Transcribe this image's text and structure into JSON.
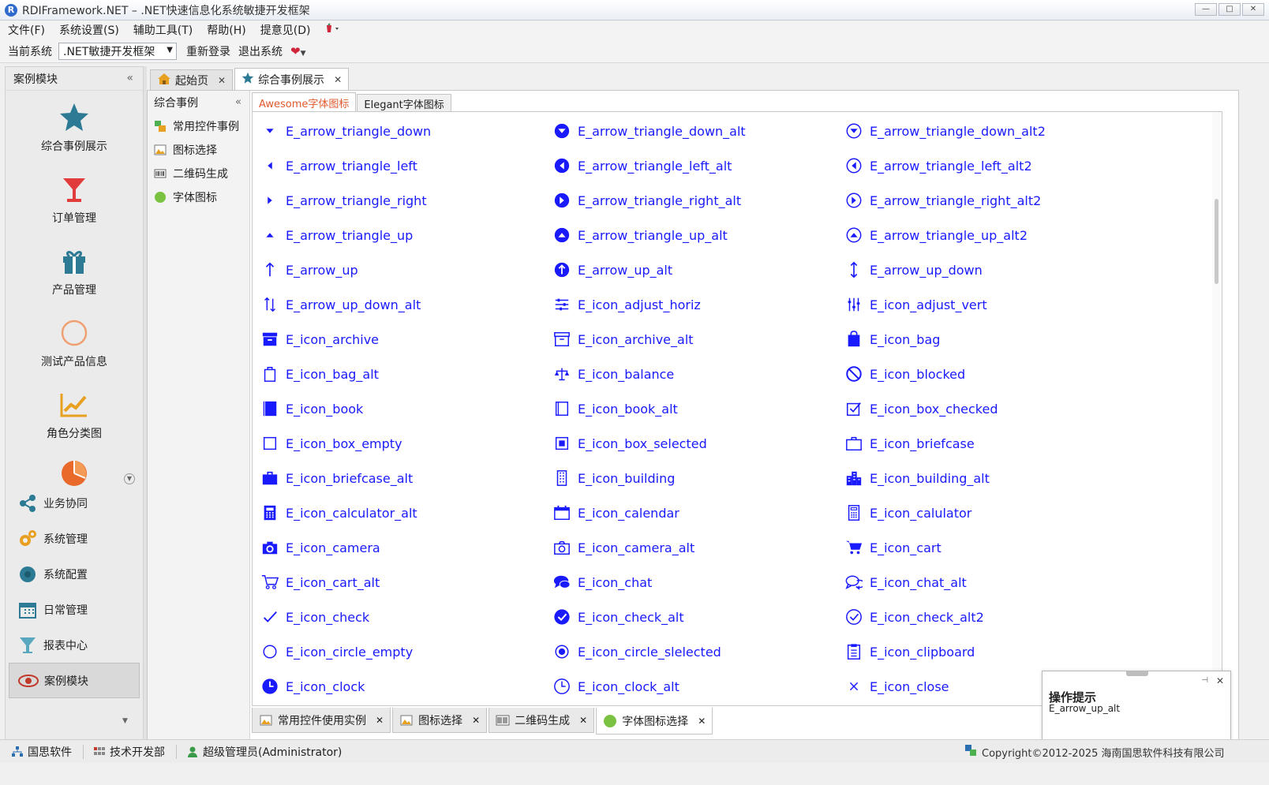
{
  "window": {
    "title": "RDIFramework.NET – .NET快速信息化系统敏捷开发框架",
    "logo_letter": "R",
    "buttons": [
      "—",
      "□",
      "✕"
    ]
  },
  "menu": {
    "items": [
      "文件(F)",
      "系统设置(S)",
      "辅助工具(T)",
      "帮助(H)",
      "提意见(D)"
    ]
  },
  "toolbar": {
    "current_system_label": "当前系统",
    "system_select_value": ".NET敏捷开发框架",
    "relogin_label": "重新登录",
    "exit_label": "退出系统"
  },
  "leftnav": {
    "title": "案例模块",
    "big_items": [
      {
        "label": "综合事例展示",
        "icon": "star-icon"
      },
      {
        "label": "订单管理",
        "icon": "cocktail-icon"
      },
      {
        "label": "产品管理",
        "icon": "gift-icon"
      },
      {
        "label": "测试产品信息",
        "icon": "circle-icon"
      },
      {
        "label": "角色分类图",
        "icon": "chart-icon"
      },
      {
        "label": "",
        "icon": "pie-icon"
      }
    ],
    "small_items": [
      {
        "label": "业务协同",
        "icon": "share-icon"
      },
      {
        "label": "系统管理",
        "icon": "gears-icon"
      },
      {
        "label": "系统配置",
        "icon": "cog-icon"
      },
      {
        "label": "日常管理",
        "icon": "calendar-icon"
      },
      {
        "label": "报表中心",
        "icon": "funnel-icon"
      },
      {
        "label": "案例模块",
        "icon": "eye-icon"
      }
    ]
  },
  "doc_tabs": [
    {
      "label": "起始页",
      "icon": "home-icon"
    },
    {
      "label": "综合事例展示",
      "icon": "star-icon"
    }
  ],
  "subnav": {
    "title": "综合事例",
    "items": [
      {
        "label": "常用控件事例"
      },
      {
        "label": "图标选择"
      },
      {
        "label": "二维码生成"
      },
      {
        "label": "字体图标"
      }
    ]
  },
  "icon_tabs": [
    "Awesome字体图标",
    "Elegant字体图标"
  ],
  "icons": [
    "E_arrow_triangle_down",
    "E_arrow_triangle_down_alt",
    "E_arrow_triangle_down_alt2",
    "E_arrow_triangle_left",
    "E_arrow_triangle_left_alt",
    "E_arrow_triangle_left_alt2",
    "E_arrow_triangle_right",
    "E_arrow_triangle_right_alt",
    "E_arrow_triangle_right_alt2",
    "E_arrow_triangle_up",
    "E_arrow_triangle_up_alt",
    "E_arrow_triangle_up_alt2",
    "E_arrow_up",
    "E_arrow_up_alt",
    "E_arrow_up_down",
    "E_arrow_up_down_alt",
    "E_icon_adjust_horiz",
    "E_icon_adjust_vert",
    "E_icon_archive",
    "E_icon_archive_alt",
    "E_icon_bag",
    "E_icon_bag_alt",
    "E_icon_balance",
    "E_icon_blocked",
    "E_icon_book",
    "E_icon_book_alt",
    "E_icon_box_checked",
    "E_icon_box_empty",
    "E_icon_box_selected",
    "E_icon_briefcase",
    "E_icon_briefcase_alt",
    "E_icon_building",
    "E_icon_building_alt",
    "E_icon_calculator_alt",
    "E_icon_calendar",
    "E_icon_calulator",
    "E_icon_camera",
    "E_icon_camera_alt",
    "E_icon_cart",
    "E_icon_cart_alt",
    "E_icon_chat",
    "E_icon_chat_alt",
    "E_icon_check",
    "E_icon_check_alt",
    "E_icon_check_alt2",
    "E_icon_circle_empty",
    "E_icon_circle_slelected",
    "E_icon_clipboard",
    "E_icon_clock",
    "E_icon_clock_alt",
    "E_icon_close"
  ],
  "bottom_tabs": [
    {
      "label": "常用控件使用实例"
    },
    {
      "label": "图标选择"
    },
    {
      "label": "二维码生成"
    },
    {
      "label": "字体图标选择"
    }
  ],
  "tooltip": {
    "title": "操作提示",
    "message": "E_arrow_up_alt"
  },
  "statusbar": {
    "company": "国思软件",
    "department": "技术开发部",
    "user": "超级管理员(Administrator)",
    "copyright": "Copyright©2012-2025 海南国思软件科技有限公司"
  },
  "colors": {
    "icon_text": "#1a1aff",
    "active_tab_text": "#e05a2c",
    "accent_teal": "#2c7a94"
  }
}
